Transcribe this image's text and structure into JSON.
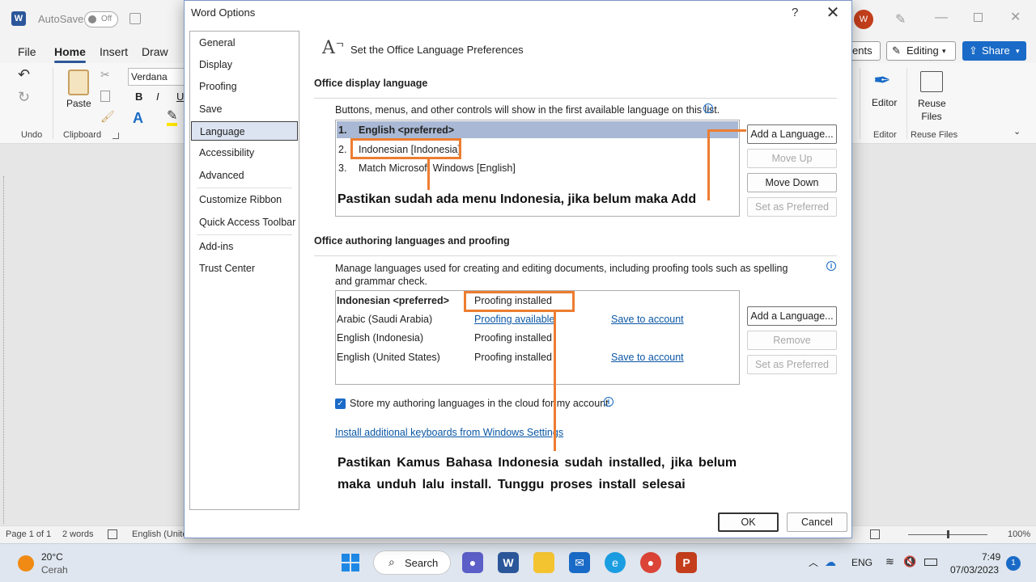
{
  "word": {
    "title_bar": {
      "autosave_label": "AutoSave",
      "autosave_state": "Off",
      "avatar_initial": "W",
      "avatar_color": "#c43e1c"
    },
    "tabs": [
      "File",
      "Home",
      "Insert",
      "Draw"
    ],
    "active_tab": "Home",
    "right_buttons": {
      "comments_partial": "ents",
      "editing": "Editing",
      "share": "Share"
    },
    "ribbon": {
      "undo_group": "Undo",
      "paste_label": "Paste",
      "clipboard_group": "Clipboard",
      "font_name": "Verdana",
      "bold": "B",
      "italic": "I",
      "underline": "U",
      "editor_label": "Editor",
      "editor_group": "Editor",
      "reuse_label": "Reuse Files",
      "reuse_group": "Reuse Files"
    },
    "status_bar": {
      "page": "Page 1 of 1",
      "words": "2 words",
      "language": "English (Unite",
      "zoom": "100%"
    }
  },
  "taskbar": {
    "weather_temp": "20°C",
    "weather_desc": "Cerah",
    "search_label": "Search",
    "lang": "ENG",
    "time": "7:49",
    "date": "07/03/2023",
    "notification_count": "1"
  },
  "dialog": {
    "title": "Word Options",
    "help": "?",
    "close": "✕",
    "nav": [
      "General",
      "Display",
      "Proofing",
      "Save",
      "Language",
      "Accessibility",
      "Advanced",
      "Customize Ribbon",
      "Quick Access Toolbar",
      "Add-ins",
      "Trust Center"
    ],
    "selected_nav": "Language",
    "header": "Set the Office Language Preferences",
    "display_section": {
      "heading": "Office display language",
      "description": "Buttons, menus, and other controls will show in the first available language on this list.",
      "languages": [
        {
          "num": "1.",
          "name": "English <preferred>"
        },
        {
          "num": "2.",
          "name": "Indonesian [Indonesia]"
        },
        {
          "num": "3.",
          "name": "Match Microsoft Windows [English]"
        }
      ],
      "buttons": [
        "Add a Language...",
        "Move Up",
        "Move Down",
        "Set as Preferred"
      ]
    },
    "authoring_section": {
      "heading": "Office authoring languages and proofing",
      "description": "Manage languages used for creating and editing documents, including proofing tools such as spelling and grammar check.",
      "rows": [
        {
          "language": "Indonesian <preferred>",
          "status": "Proofing installed",
          "action": ""
        },
        {
          "language": "Arabic (Saudi Arabia)",
          "status": "Proofing available",
          "action": "Save to account"
        },
        {
          "language": "English (Indonesia)",
          "status": "Proofing installed",
          "action": ""
        },
        {
          "language": "English (United States)",
          "status": "Proofing installed",
          "action": "Save to account"
        }
      ],
      "buttons": [
        "Add a Language...",
        "Remove",
        "Set as Preferred"
      ],
      "cloud_checkbox": "Store my authoring languages in the cloud for my account.",
      "cloud_checked": true,
      "keyboard_link": "Install additional keyboards from Windows Settings"
    },
    "ok": "OK",
    "cancel": "Cancel"
  },
  "annotations": {
    "note1": "Pastikan sudah ada menu Indonesia, jika belum maka Add",
    "note2_line1": "Pastikan Kamus Bahasa Indonesia sudah installed, jika belum",
    "note2_line2": "maka unduh lalu install. Tunggu proses install selesai",
    "color": "#ed7d31"
  }
}
